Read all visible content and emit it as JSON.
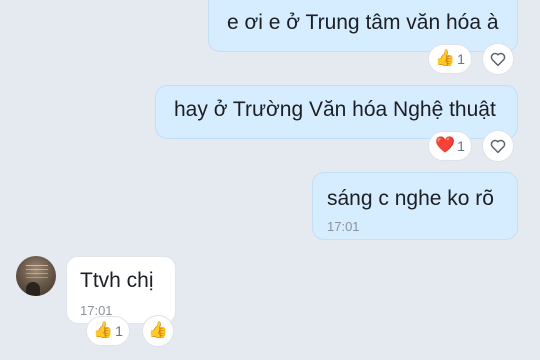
{
  "messages": [
    {
      "text": "e ơi e ở Trung tâm văn hóa à",
      "reaction_emoji": "👍",
      "reaction_count": "1",
      "add_icon": "heart-outline-icon"
    },
    {
      "text": "hay ở Trường Văn hóa Nghệ thuật",
      "reaction_emoji": "❤️",
      "reaction_count": "1",
      "add_icon": "heart-outline-icon"
    },
    {
      "text": "sáng c nghe ko rõ",
      "time": "17:01"
    },
    {
      "text": "Ttvh chị",
      "time": "17:01",
      "reaction_emoji": "👍",
      "reaction_count": "1",
      "add_emoji": "👍"
    }
  ],
  "colors": {
    "sent_bubble": "#d6ecff",
    "received_bubble": "#ffffff",
    "background": "#e5e9f0"
  }
}
